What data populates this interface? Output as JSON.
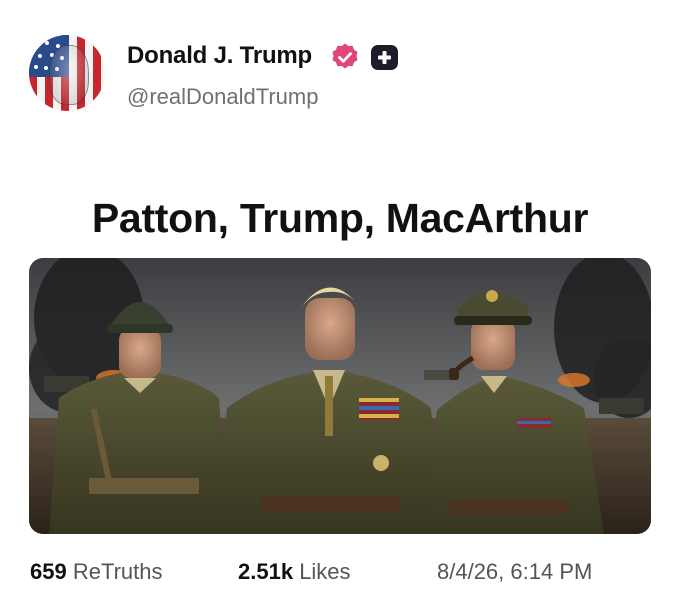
{
  "author": {
    "display_name": "Donald J. Trump",
    "handle": "@realDonaldTrump",
    "verified_color": "#e0457b",
    "badge_icon": "plus-icon"
  },
  "post": {
    "text": "Patton, Trump, MacArthur",
    "image_icon": "generals-illustration"
  },
  "stats": {
    "retruths_count": "659",
    "retruths_label": "ReTruths",
    "likes_count": "2.51k",
    "likes_label": "Likes",
    "timestamp": "8/4/26, 6:14 PM"
  }
}
